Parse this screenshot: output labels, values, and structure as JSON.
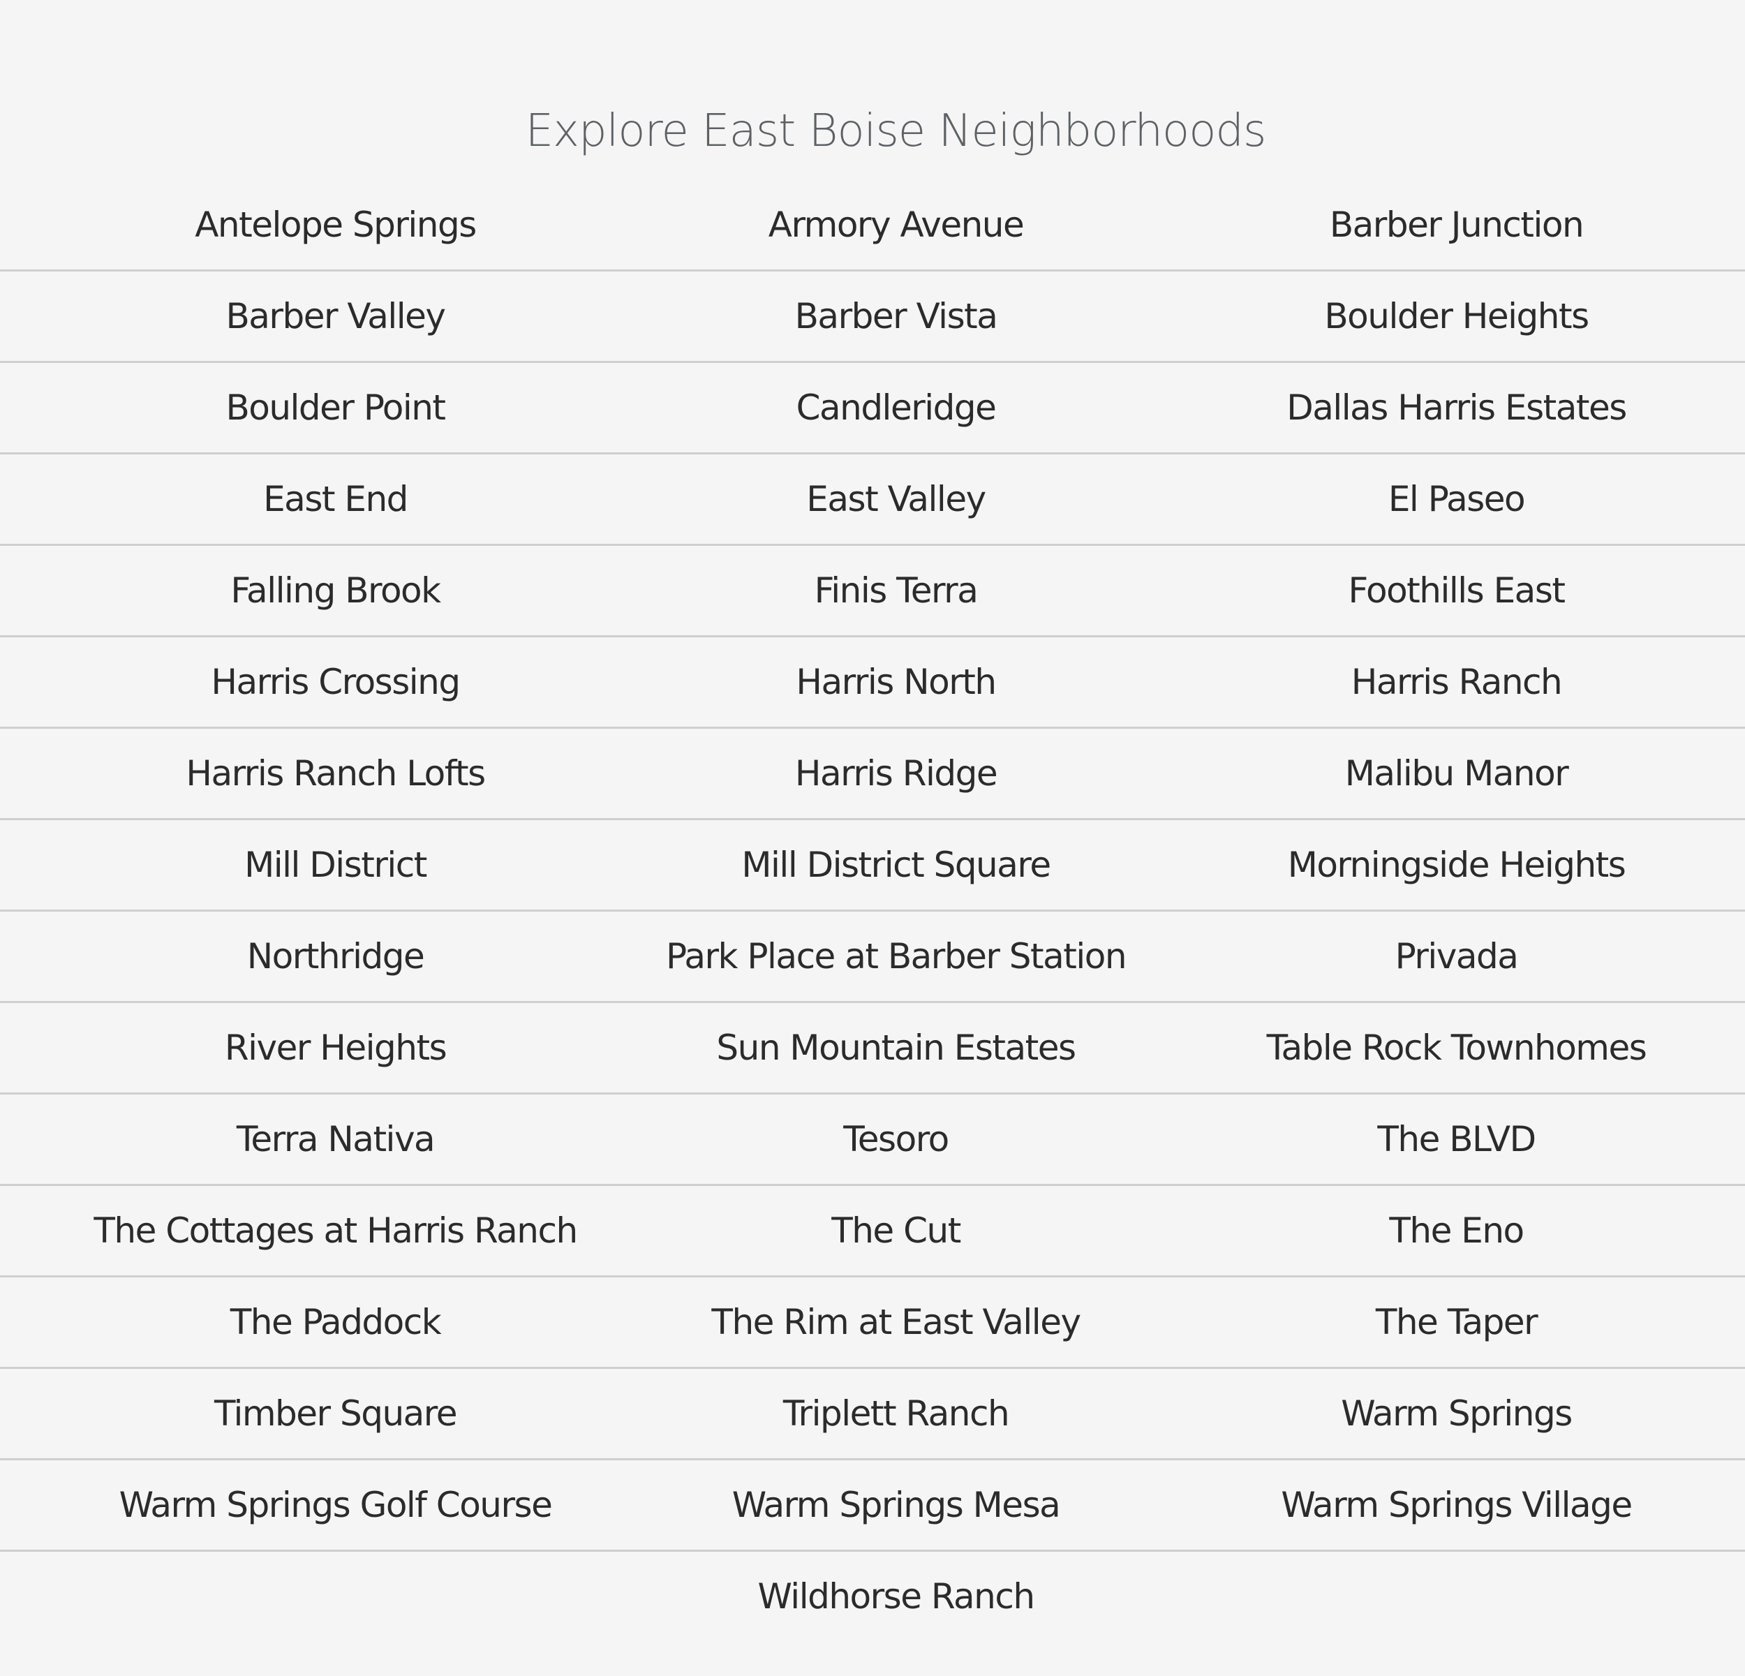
{
  "page": {
    "title": "Explore East Boise Neighborhoods"
  },
  "neighborhoods": [
    "Antelope Springs",
    "Armory Avenue",
    "Barber Junction",
    "Barber Valley",
    "Barber Vista",
    "Boulder Heights",
    "Boulder Point",
    "Candleridge",
    "Dallas Harris Estates",
    "East End",
    "East Valley",
    "El Paseo",
    "Falling Brook",
    "Finis Terra",
    "Foothills East",
    "Harris Crossing",
    "Harris North",
    "Harris Ranch",
    "Harris Ranch Lofts",
    "Harris Ridge",
    "Malibu Manor",
    "Mill District",
    "Mill District Square",
    "Morningside Heights",
    "Northridge",
    "Park Place at Barber Station",
    "Privada",
    "River Heights",
    "Sun Mountain Estates",
    "Table Rock Townhomes",
    "Terra Nativa",
    "Tesoro",
    "The BLVD",
    "The Cottages at Harris Ranch",
    "The Cut",
    "The Eno",
    "The Paddock",
    "The Rim at East Valley",
    "The Taper",
    "Timber Square",
    "Triplett Ranch",
    "Warm Springs",
    "Warm Springs Golf Course",
    "Warm Springs Mesa",
    "Warm Springs Village",
    "Wildhorse Ranch"
  ],
  "colors": {
    "background": "#f5f5f5",
    "title": "#5e6163",
    "link_text": "#2b2b2b",
    "divider": "#cfcfcf"
  }
}
